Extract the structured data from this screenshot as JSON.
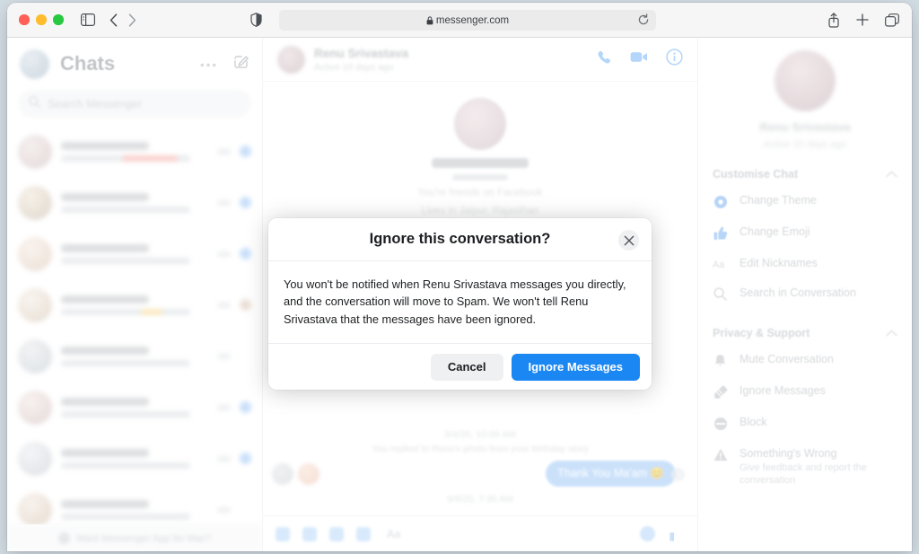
{
  "browser": {
    "url": "messenger.com",
    "lock_icon": "lock-icon",
    "reload_icon": "reload-icon",
    "shield_icon": "privacy-shield-icon",
    "sidebar_icon": "sidebar-toggle-icon",
    "back_icon": "chevron-left-icon",
    "forward_icon": "chevron-right-icon",
    "share_icon": "share-icon",
    "newtab_icon": "plus-icon",
    "tabs_icon": "tab-overview-icon"
  },
  "sidebar": {
    "title": "Chats",
    "more_icon": "ellipsis-icon",
    "compose_icon": "compose-icon",
    "search": {
      "placeholder": "Search Messenger",
      "icon": "search-icon"
    },
    "mac_app_banner": "Want Messenger App for Mac?",
    "chat_rows": [
      {
        "seen": "blue",
        "preview_style": "hl"
      },
      {
        "seen": "blue",
        "preview_style": "plain"
      },
      {
        "seen": "blue",
        "preview_style": "plain"
      },
      {
        "seen": "warm",
        "preview_style": "emo"
      },
      {
        "seen": "none",
        "preview_style": "plain"
      },
      {
        "seen": "blue",
        "preview_style": "plain"
      },
      {
        "seen": "blue",
        "preview_style": "plain"
      },
      {
        "seen": "none",
        "preview_style": "plain"
      }
    ]
  },
  "conversation": {
    "header": {
      "name": "Renu Srivastava",
      "status": "Active 10 days ago",
      "call_icon": "phone-icon",
      "video_icon": "video-camera-icon",
      "info_icon": "info-icon"
    },
    "profile": {
      "friends_line": "You're friends on Facebook",
      "location_line": "Lives in Jaipur, Rajasthan"
    },
    "messages": [
      {
        "type": "timestamp",
        "text": "3/4/20, 10:09 AM"
      },
      {
        "type": "reply_note",
        "text": "You replied to Renu's photo from your birthday story"
      },
      {
        "type": "outgoing",
        "text": "Thank You Ma'am 😊"
      },
      {
        "type": "timestamp",
        "text": "9/8/20, 7:35 AM"
      }
    ],
    "composer": {
      "placeholder": "Aa",
      "icons": [
        "add-icon",
        "photo-icon",
        "sticker-icon",
        "gif-icon"
      ],
      "emoji_icon": "emoji-icon",
      "like_icon": "thumbs-up-icon"
    }
  },
  "details": {
    "name": "Renu Srivastava",
    "status": "Active 10 days ago",
    "sections": [
      {
        "title": "Customise Chat",
        "chevron_icon": "chevron-up-icon",
        "items": [
          {
            "label": "Change Theme",
            "icon": "color-circle-icon",
            "icon_color": "blue"
          },
          {
            "label": "Change Emoji",
            "icon": "thumbs-up-icon",
            "icon_color": "blue"
          },
          {
            "label": "Edit Nicknames",
            "icon": "aa-text-icon",
            "icon_color": "grey"
          },
          {
            "label": "Search in Conversation",
            "icon": "search-icon",
            "icon_color": "grey"
          }
        ]
      },
      {
        "title": "Privacy & Support",
        "chevron_icon": "chevron-up-icon",
        "items": [
          {
            "label": "Mute Conversation",
            "icon": "bell-icon",
            "icon_color": "grey"
          },
          {
            "label": "Ignore Messages",
            "icon": "ignore-icon",
            "icon_color": "grey"
          },
          {
            "label": "Block",
            "icon": "block-icon",
            "icon_color": "grey"
          },
          {
            "label": "Something's Wrong",
            "icon": "warning-triangle-icon",
            "icon_color": "grey",
            "sublabel": "Give feedback and report the conversation"
          }
        ]
      }
    ]
  },
  "modal": {
    "title": "Ignore this conversation?",
    "body": "You won't be notified when Renu Srivastava messages you directly, and the conversation will move to Spam. We won't tell Renu Srivastava that the messages have been ignored.",
    "close_icon": "close-icon",
    "cancel_label": "Cancel",
    "confirm_label": "Ignore Messages",
    "confirm_color": "#1b87f2",
    "cancel_color": "#eff0f2"
  }
}
